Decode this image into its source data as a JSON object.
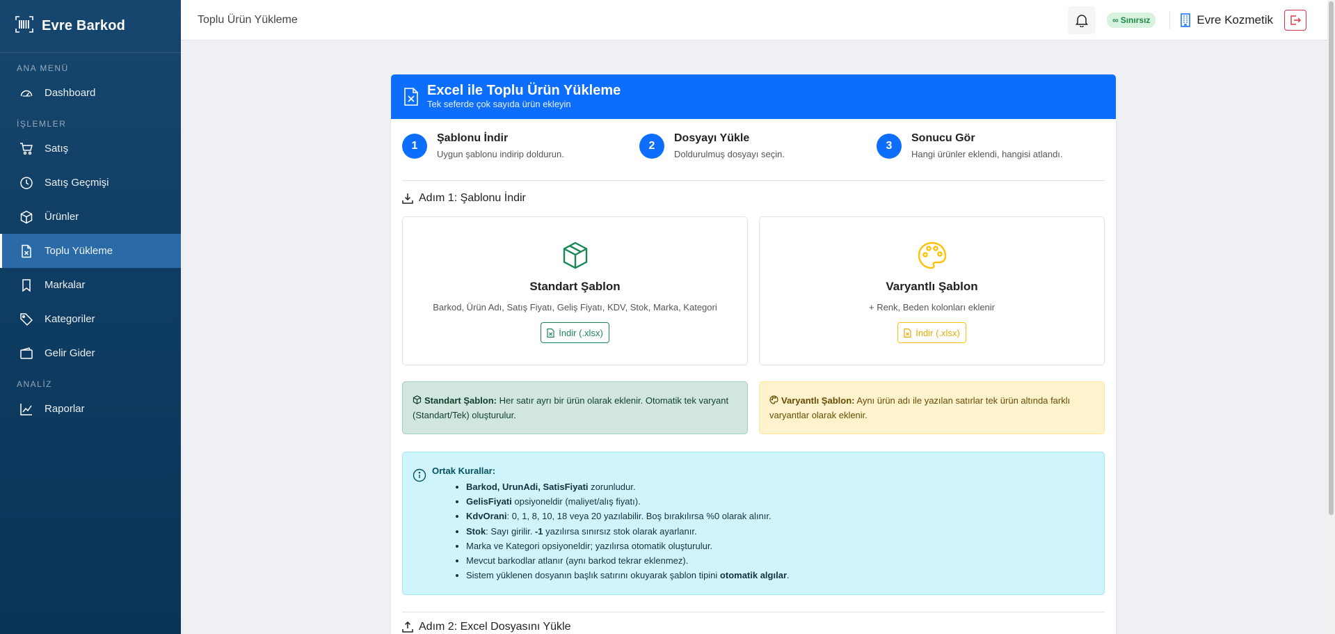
{
  "brand": {
    "name": "Evre Barkod"
  },
  "sidebar": {
    "sections": [
      {
        "label": "ANA MENÜ",
        "items": [
          {
            "label": "Dashboard",
            "icon": "gauge-icon"
          }
        ]
      },
      {
        "label": "İŞLEMLER",
        "items": [
          {
            "label": "Satış",
            "icon": "cart-icon"
          },
          {
            "label": "Satış Geçmişi",
            "icon": "clock-icon"
          },
          {
            "label": "Ürünler",
            "icon": "box-icon"
          },
          {
            "label": "Toplu Yükleme",
            "icon": "excel-icon",
            "active": true
          },
          {
            "label": "Markalar",
            "icon": "bookmark-icon"
          },
          {
            "label": "Kategoriler",
            "icon": "tags-icon"
          },
          {
            "label": "Gelir Gider",
            "icon": "wallet-icon"
          }
        ]
      },
      {
        "label": "ANALİZ",
        "items": [
          {
            "label": "Raporlar",
            "icon": "chart-icon"
          }
        ]
      }
    ]
  },
  "header": {
    "title": "Toplu Ürün Yükleme",
    "badge": "Sınırsız",
    "badge_symbol": "∞",
    "store": "Evre Kozmetik"
  },
  "card": {
    "title": "Excel ile Toplu Ürün Yükleme",
    "subtitle": "Tek seferde çok sayıda ürün ekleyin"
  },
  "steps": [
    {
      "num": "1",
      "title": "Şablonu İndir",
      "desc": "Uygun şablonu indirip doldurun."
    },
    {
      "num": "2",
      "title": "Dosyayı Yükle",
      "desc": "Doldurulmuş dosyayı seçin."
    },
    {
      "num": "3",
      "title": "Sonucu Gör",
      "desc": "Hangi ürünler eklendi, hangisi atlandı."
    }
  ],
  "step1": {
    "title": "Adım 1: Şablonu İndir",
    "standard": {
      "title": "Standart Şablon",
      "desc": "Barkod, Ürün Adı, Satış Fiyatı, Geliş Fiyatı, KDV, Stok, Marka, Kategori",
      "button": "İndir (.xlsx)"
    },
    "variant": {
      "title": "Varyantlı Şablon",
      "desc": "+ Renk, Beden kolonları eklenir",
      "button": "İndir (.xlsx)"
    }
  },
  "alerts": {
    "standard": {
      "bold": "Standart Şablon:",
      "text": " Her satır ayrı bir ürün olarak eklenir. Otomatik tek varyant (Standart/Tek) oluşturulur."
    },
    "variant": {
      "bold": "Varyantlı Şablon:",
      "text": " Aynı ürün adı ile yazılan satırlar tek ürün altında farklı varyantlar olarak eklenir."
    }
  },
  "rules": {
    "title": "Ortak Kurallar:",
    "items": [
      {
        "bold": "Barkod, UrunAdi, SatisFiyati",
        "text": " zorunludur."
      },
      {
        "bold": "GelisFiyati",
        "text": " opsiyoneldir (maliyet/alış fiyatı)."
      },
      {
        "bold": "KdvOrani",
        "text": ": 0, 1, 8, 10, 18 veya 20 yazılabilir. Boş bırakılırsa %0 olarak alınır."
      },
      {
        "bold": "Stok",
        "text": ": Sayı girilir. ",
        "bold2": "-1",
        "text2": " yazılırsa sınırsız stok olarak ayarlanır."
      },
      {
        "text": "Marka ve Kategori opsiyoneldir; yazılırsa otomatik oluşturulur."
      },
      {
        "text": "Mevcut barkodlar atlanır (aynı barkod tekrar eklenmez)."
      },
      {
        "text": "Sistem yüklenen dosyanın başlık satırını okuyarak şablon tipini ",
        "bold": "otomatik algılar",
        "text2": "."
      }
    ]
  },
  "step2": {
    "title": "Adım 2: Excel Dosyasını Yükle"
  },
  "colors": {
    "primary": "#0d6efd",
    "sidebar": "#0f3c62",
    "success": "#198754",
    "warning": "#ffc107",
    "info_bg": "#cff4fc"
  }
}
